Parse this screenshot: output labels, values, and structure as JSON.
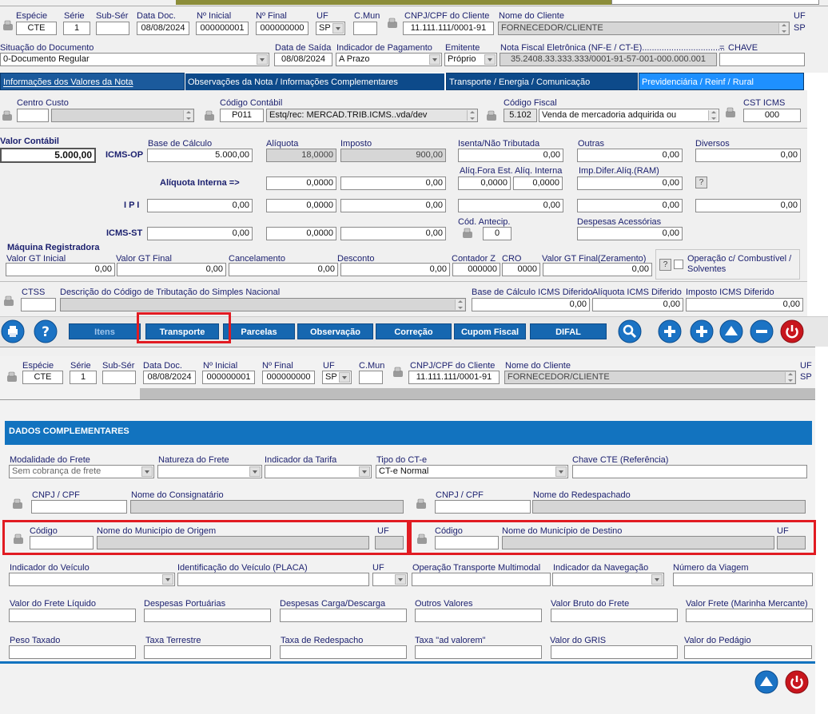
{
  "header1": {
    "especie_label": "Espécie",
    "especie": "CTE",
    "serie_label": "Série",
    "serie": "1",
    "subser_label": "Sub-Sér",
    "subser": "",
    "datadoc_label": "Data Doc.",
    "datadoc": "08/08/2024",
    "ninicial_label": "Nº Inicial",
    "ninicial": "000000001",
    "nfinal_label": "Nº Final",
    "nfinal": "000000000",
    "uf_label": "UF",
    "uf": "SP",
    "cmun_label": "C.Mun",
    "cmun": "",
    "cnpj_label": "CNPJ/CPF do Cliente",
    "cnpj": "11.111.111/0001-91",
    "nome_label": "Nome do Cliente",
    "nome": "FORNECEDOR/CLIENTE",
    "uf2_label": "UF",
    "uf2": "SP"
  },
  "row2": {
    "situacao_label": "Situação do Documento",
    "situacao": "0-Documento Regular",
    "datasaida_label": "Data de Saída",
    "datasaida": "08/08/2024",
    "indpag_label": "Indicador de Pagamento",
    "indpag": "A Prazo",
    "emitente_label": "Emitente",
    "emitente": "Próprio",
    "nfe_label": "Nota Fiscal Eletrônica (NF-E / CT-E)..................................",
    "nfe": "35.2408.33.333.333/0001-91-57-001-000.000.001",
    "eq": "=",
    "chave_label": "CHAVE",
    "chave": ""
  },
  "tabs": [
    {
      "label": "Informações dos Valores da Nota",
      "ul": "I"
    },
    {
      "label": "Observações da Nota / Informações Complementares",
      "ul": "O"
    },
    {
      "label": "Transporte / Energia / Comunicação",
      "ul": "T"
    },
    {
      "label": "Previdenciária / Reinf / Rural",
      "ul": "P"
    }
  ],
  "valores": {
    "centro_label": "Centro Custo",
    "centro": "",
    "centro_desc": "",
    "contabil_label": "Código Contábil",
    "contabil": "P011",
    "contabil_desc": "Estq/rec: MERCAD.TRIB.ICMS..vda/dev",
    "fiscal_label": "Código Fiscal",
    "fiscal": "5.102",
    "fiscal_desc": "Venda de mercadoria adquirida ou",
    "csticms_label": "CST ICMS",
    "csticms": "000",
    "valorcont_label": "Valor Contábil",
    "valorcont": "5.000,00",
    "base_label": "Base de Cálculo",
    "aliq_label": "Alíquota",
    "imposto_label": "Imposto",
    "isenta_label": "Isenta/Não Tributada",
    "outras_label": "Outras",
    "diversos_label": "Diversos",
    "icmsop_label": "ICMS-OP",
    "icmsop": {
      "base": "5.000,00",
      "aliq": "18,0000",
      "imposto": "900,00",
      "isenta": "0,00",
      "outras": "0,00",
      "diversos": "0,00"
    },
    "aliqfora_label": "Alíq.Fora Est.",
    "aliqint_label": "Alíq. Interna",
    "impdifer_label": "Imp.Difer.Alíq.(RAM)",
    "aliqinterna_label": "Alíquota Interna =>",
    "aliqrow": {
      "aliq": "0,0000",
      "imposto": "0,00",
      "fora": "0,0000",
      "interna": "0,0000",
      "difer": "0,00"
    },
    "ipi_label": "I P I",
    "ipi": {
      "base": "0,00",
      "aliq": "0,0000",
      "imposto": "0,00",
      "isenta": "0,00",
      "outras": "0,00",
      "diversos": "0,00"
    },
    "codantecip_label": "Cód. Antecip.",
    "codantecip": "0",
    "despacess_label": "Despesas Acessórias",
    "despacess": "0,00",
    "icmsst_label": "ICMS-ST",
    "icmsst": {
      "base": "0,00",
      "aliq": "0,0000",
      "imposto": "0,00"
    },
    "help_q": "?"
  },
  "maquina": {
    "title": "Máquina Registradora",
    "gtini_label": "Valor GT Inicial",
    "gtini": "0,00",
    "gtfin_label": "Valor GT Final",
    "gtfin": "0,00",
    "cancel_label": "Cancelamento",
    "cancel": "0,00",
    "desc_label": "Desconto",
    "desc": "0,00",
    "contz_label": "Contador Z",
    "contz": "000000",
    "cro_label": "CRO",
    "cro": "0000",
    "gtzer_label": "Valor GT Final(Zeramento)",
    "gtzer": "0,00",
    "combust_label": "Operação c/ Combustível / Solventes",
    "help_q": "?"
  },
  "simples": {
    "ctss_label": "CTSS",
    "ctss": "",
    "desc_label": "Descrição do Código de Tributação do Simples Nacional",
    "desc": "",
    "basedif_label": "Base de Cálculo ICMS Diferido",
    "basedif": "0,00",
    "aliqdif_label": "Alíquota ICMS Diferido",
    "aliqdif": "0,00",
    "impdif_label": "Imposto ICMS Diferido",
    "impdif": "0,00"
  },
  "toolbar": {
    "itens": "Itens",
    "transporte": "Transporte",
    "parcelas": "Parcelas",
    "observacao": "Observação",
    "correcao": "Correção",
    "cupom": "Cupom Fiscal",
    "difal": "DIFAL"
  },
  "header2": {
    "especie_label": "Espécie",
    "especie": "CTE",
    "serie_label": "Série",
    "serie": "1",
    "subser_label": "Sub-Sér",
    "subser": "",
    "datadoc_label": "Data Doc.",
    "datadoc": "08/08/2024",
    "ninicial_label": "Nº Inicial",
    "ninicial": "000000001",
    "nfinal_label": "Nº Final",
    "nfinal": "000000000",
    "uf_label": "UF",
    "uf": "SP",
    "cmun_label": "C.Mun",
    "cmun": "",
    "cnpj_label": "CNPJ/CPF do Cliente",
    "cnpj": "11.111.111/0001-91",
    "nome_label": "Nome do Cliente",
    "nome": "FORNECEDOR/CLIENTE",
    "uf2_label": "UF",
    "uf2": "SP"
  },
  "dados": {
    "title": "DADOS COMPLEMENTARES",
    "modfrete_label": "Modalidade do Frete",
    "modfrete": "Sem cobrança de frete",
    "natfrete_label": "Natureza do Frete",
    "natfrete": "",
    "indtarifa_label": "Indicador da Tarifa",
    "indtarifa": "",
    "tipocte_label": "Tipo do CT-e",
    "tipocte": "CT-e Normal",
    "chavecte_label": "Chave CTE (Referência)",
    "chavecte": "",
    "cnpj1_label": "CNPJ / CPF",
    "cnpj1": "",
    "consig_label": "Nome do Consignatário",
    "consig": "",
    "cnpj2_label": "CNPJ / CPF",
    "cnpj2": "",
    "redesp_label": "Nome do Redespachado",
    "redesp": "",
    "cod1_label": "Código",
    "cod1": "",
    "munorig_label": "Nome do Município de Origem",
    "munorig": "",
    "uf1_label": "UF",
    "uf1": "",
    "cod2_label": "Código",
    "cod2": "",
    "mundest_label": "Nome do Município de Destino",
    "mundest": "",
    "uf3_label": "UF",
    "uf3": "",
    "indveic_label": "Indicador do Veículo",
    "indveic": "",
    "placa_label": "Identificação do Veículo (PLACA)",
    "placa": "",
    "ufv_label": "UF",
    "ufv": "",
    "multimodal_label": "Operação Transporte Multimodal",
    "multimodal": "",
    "indnav_label": "Indicador da Navegação",
    "indnav": "",
    "numviagem_label": "Número da Viagem",
    "numviagem": "",
    "vfreteliq_label": "Valor do Frete Líquido",
    "vfreteliq": "",
    "despport_label": "Despesas Portuárias",
    "despport": "",
    "despcarga_label": "Despesas Carga/Descarga",
    "despcarga": "",
    "outros_label": "Outros Valores",
    "outros": "",
    "vbruto_label": "Valor Bruto do Frete",
    "vbruto": "",
    "vmarinha_label": "Valor Frete (Marinha Mercante)",
    "vmarinha": "",
    "peso_label": "Peso Taxado",
    "peso": "",
    "taxaterr_label": "Taxa Terrestre",
    "taxaterr": "",
    "taxaredesp_label": "Taxa de Redespacho",
    "taxaredesp": "",
    "advalorem_label": "Taxa \"ad valorem\"",
    "advalorem": "",
    "gris_label": "Valor do GRIS",
    "gris": "",
    "pedagio_label": "Valor do Pedágio",
    "pedagio": ""
  },
  "colors": {
    "tab_dark": "#0d4a8a",
    "tab_light": "#1e90ff",
    "btn_blue": "#1667b0",
    "highlight": "#e11b22",
    "header_blue": "#1273bf"
  }
}
